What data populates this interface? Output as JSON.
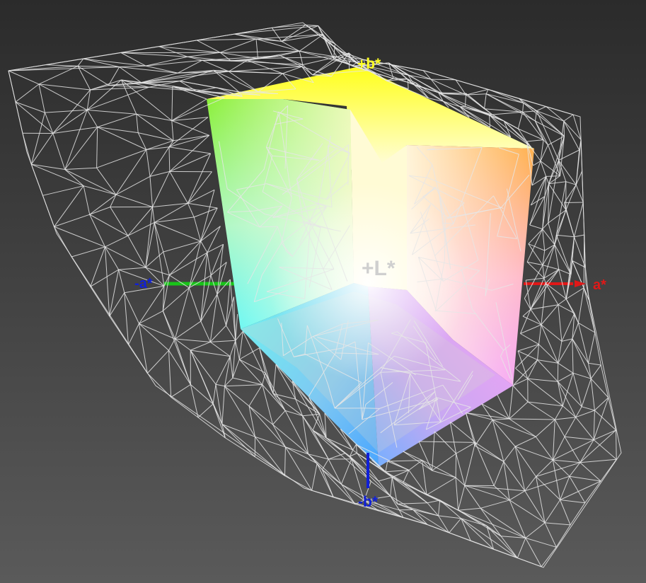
{
  "axes": {
    "b_plus": {
      "label": "+b*",
      "color": "#ffff22"
    },
    "l_plus": {
      "label": "+L*",
      "color": "#cfcfcf"
    },
    "a_plus": {
      "label": "a*",
      "color": "#e01818"
    },
    "a_minus": {
      "label": "-a*",
      "color": "#1020d8"
    },
    "b_minus": {
      "label": "-b*",
      "color": "#1020d8"
    }
  },
  "colors": {
    "background_top": "#2b2b2b",
    "background_bottom": "#5a5a5a",
    "wireframe": "#e6e6e6",
    "axis_green": "#19c419",
    "axis_red": "#e01818",
    "axis_blue": "#1020d8"
  }
}
